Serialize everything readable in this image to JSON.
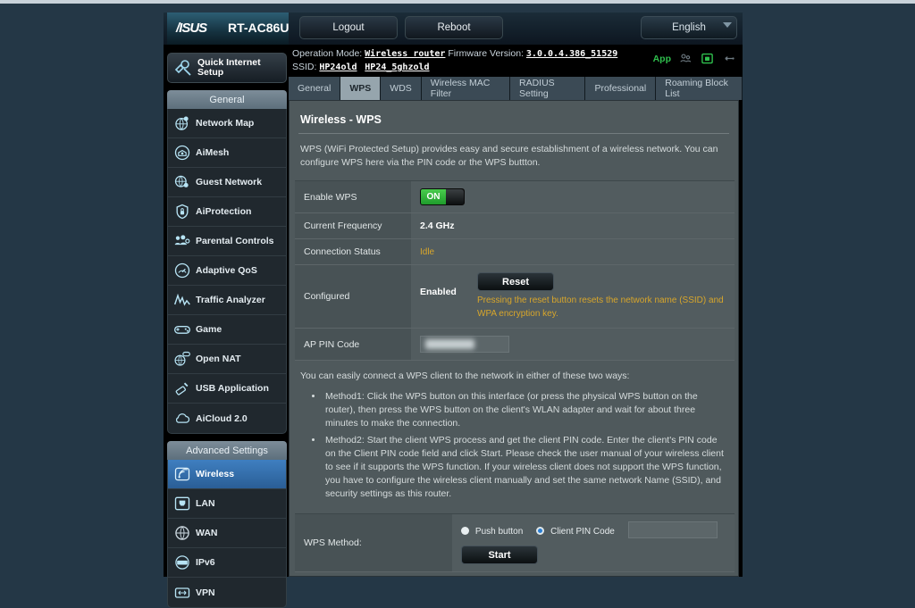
{
  "topbar": {
    "brand": "/ISUS",
    "model": "RT-AC86U",
    "logout_label": "Logout",
    "reboot_label": "Reboot",
    "language": "English"
  },
  "infobar": {
    "operation_mode_label": "Operation Mode:",
    "operation_mode_value": "Wireless router",
    "firmware_label": "Firmware Version:",
    "firmware_value": "3.0.0.4.386_51529",
    "ssid_label": "SSID:",
    "ssid_1": "HP24old",
    "ssid_2": "HP24_5ghzold",
    "app_label": "App"
  },
  "tabs": [
    {
      "label": "General",
      "active": false
    },
    {
      "label": "WPS",
      "active": true
    },
    {
      "label": "WDS",
      "active": false
    },
    {
      "label": "Wireless MAC Filter",
      "active": false
    },
    {
      "label": "RADIUS Setting",
      "active": false
    },
    {
      "label": "Professional",
      "active": false
    },
    {
      "label": "Roaming Block List",
      "active": false
    }
  ],
  "sidebar": {
    "quick_setup": "Quick Internet Setup",
    "general_header": "General",
    "general_items": [
      {
        "label": "Network Map",
        "icon": "network-map-icon"
      },
      {
        "label": "AiMesh",
        "icon": "aimesh-icon"
      },
      {
        "label": "Guest Network",
        "icon": "guest-network-icon"
      },
      {
        "label": "AiProtection",
        "icon": "shield-icon"
      },
      {
        "label": "Parental Controls",
        "icon": "parental-controls-icon"
      },
      {
        "label": "Adaptive QoS",
        "icon": "gauge-icon"
      },
      {
        "label": "Traffic Analyzer",
        "icon": "traffic-analyzer-icon"
      },
      {
        "label": "Game",
        "icon": "gamepad-icon"
      },
      {
        "label": "Open NAT",
        "icon": "open-nat-icon"
      },
      {
        "label": "USB Application",
        "icon": "usb-icon"
      },
      {
        "label": "AiCloud 2.0",
        "icon": "cloud-icon"
      }
    ],
    "advanced_header": "Advanced Settings",
    "advanced_items": [
      {
        "label": "Wireless",
        "icon": "wireless-icon",
        "active": true
      },
      {
        "label": "LAN",
        "icon": "lan-icon",
        "active": false
      },
      {
        "label": "WAN",
        "icon": "wan-globe-icon",
        "active": false
      },
      {
        "label": "IPv6",
        "icon": "ipv6-icon",
        "active": false
      },
      {
        "label": "VPN",
        "icon": "vpn-icon",
        "active": false
      }
    ]
  },
  "content": {
    "title": "Wireless - WPS",
    "description": "WPS (WiFi Protected Setup) provides easy and secure establishment of a wireless network. You can configure WPS here via the PIN code or the WPS buttton.",
    "rows": {
      "enable_wps_label": "Enable WPS",
      "enable_wps_state": "ON",
      "current_frequency_label": "Current Frequency",
      "current_frequency_value": "2.4 GHz",
      "connection_status_label": "Connection Status",
      "connection_status_value": "Idle",
      "configured_label": "Configured",
      "configured_value": "Enabled",
      "reset_button": "Reset",
      "reset_note": "Pressing the reset button resets the network name (SSID) and WPA encryption key.",
      "ap_pin_label": "AP PIN Code",
      "ap_pin_value": ""
    },
    "ways_intro": "You can easily connect a WPS client to the network in either of these two ways:",
    "method1": "Method1: Click the WPS button on this interface (or press the physical WPS button on the router), then press the WPS button on the client's WLAN adapter and wait for about three minutes to make the connection.",
    "method2": "Method2: Start the client WPS process and get the client PIN code. Enter the client's PIN code on the Client PIN code field and click Start. Please check the user manual of your wireless client to see if it supports the WPS function. If your wireless client does not support the WPS function, you have to configure the wireless client manually and set the same network Name (SSID), and security settings as this router.",
    "wps_method": {
      "label": "WPS Method:",
      "push_button_label": "Push button",
      "client_pin_label": "Client PIN Code",
      "client_pin_value": "",
      "selected": "client_pin",
      "start_button": "Start"
    }
  },
  "colors": {
    "accent_blue": "#3f7fc0",
    "status_green": "#2fbf4d",
    "warning_orange": "#d8a62b",
    "panel_bg": "#4f595c",
    "page_bg": "#243746"
  }
}
